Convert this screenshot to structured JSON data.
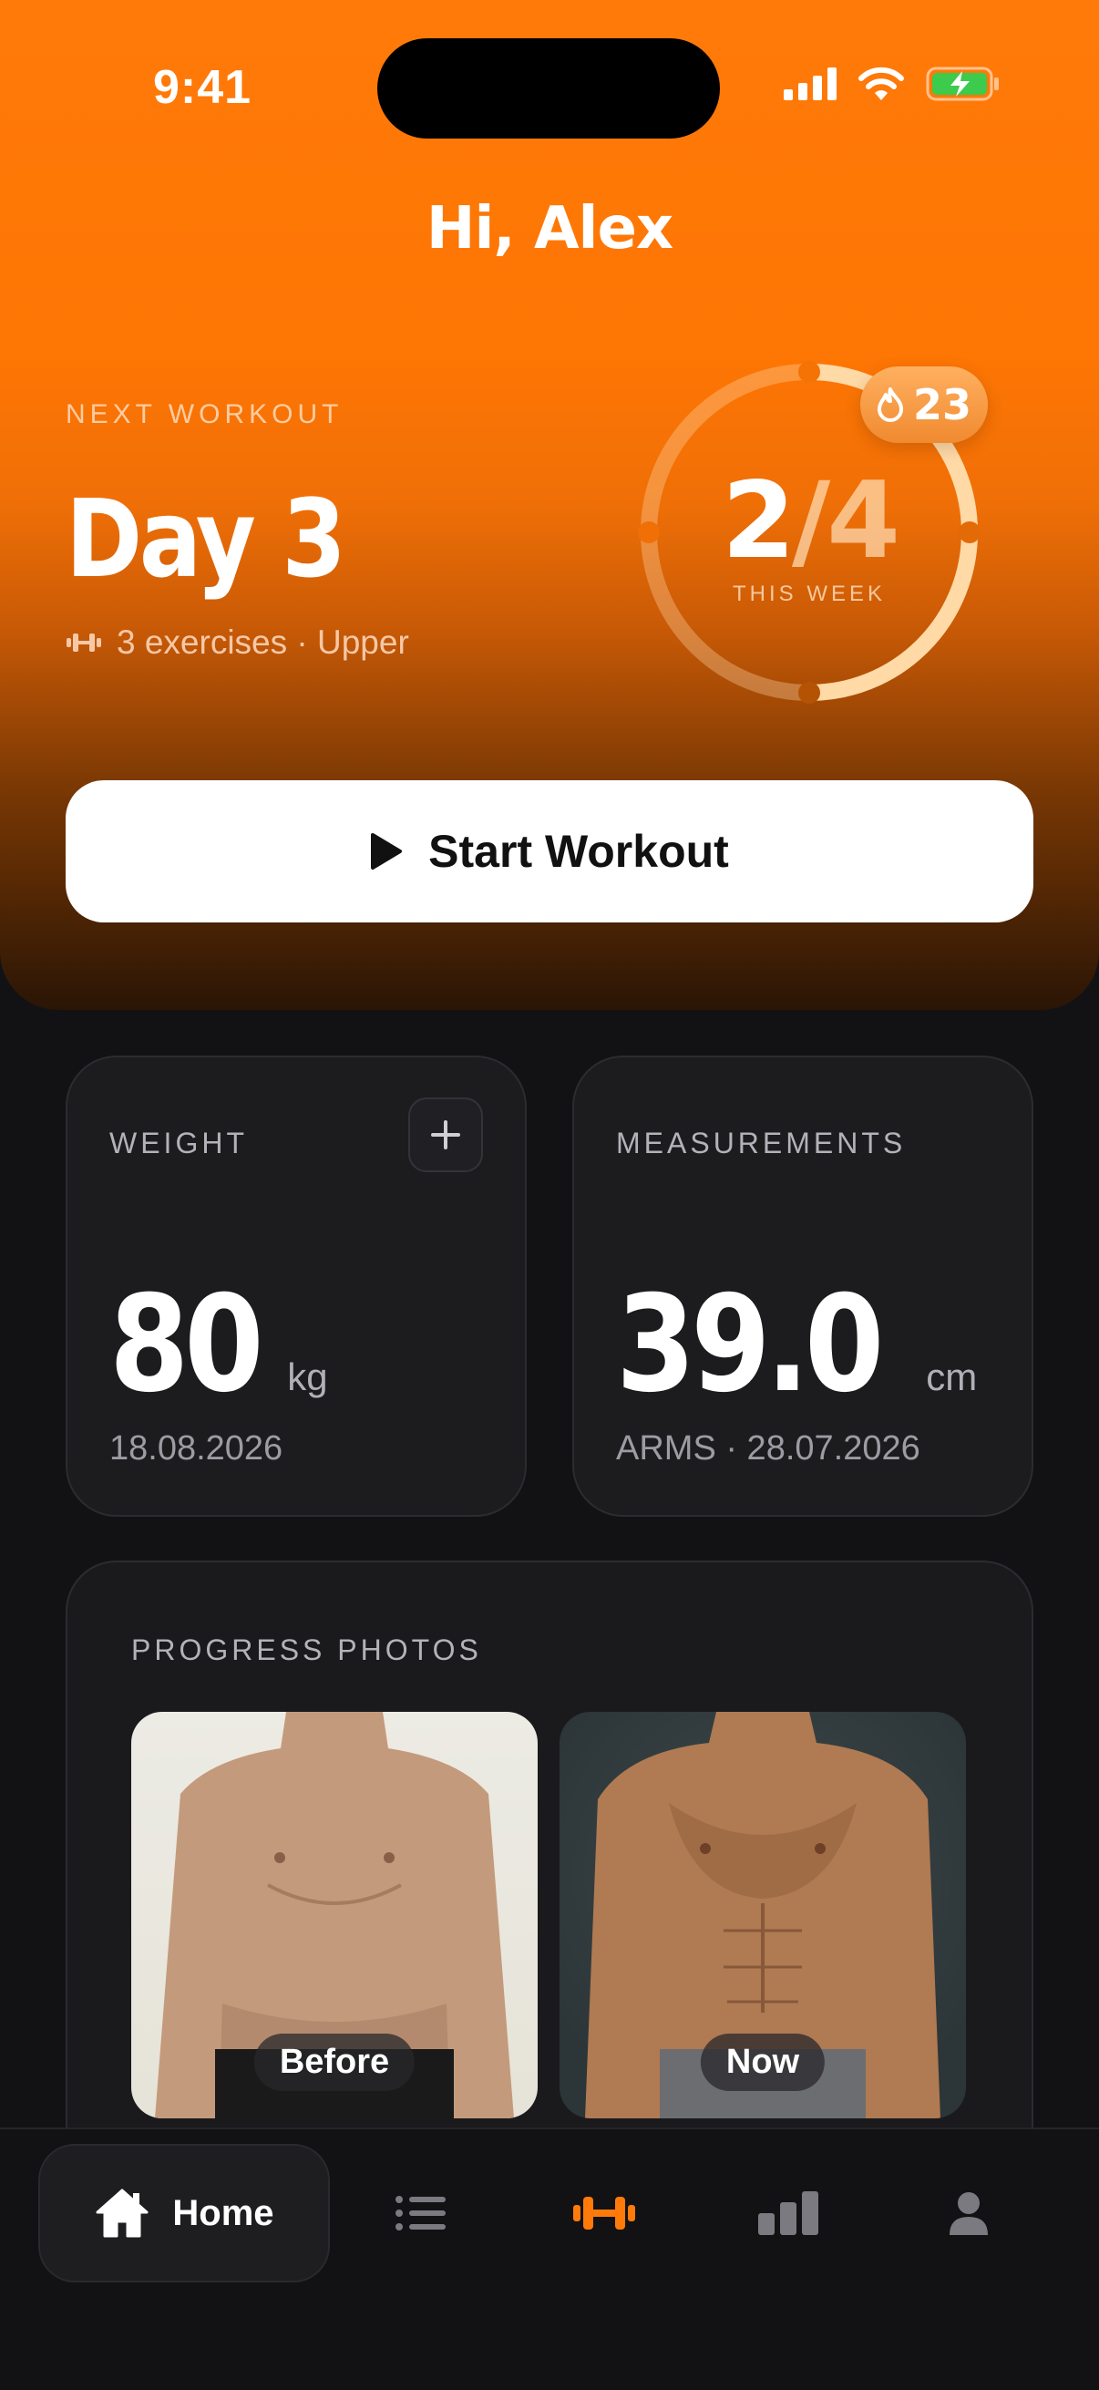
{
  "status": {
    "time": "9:41"
  },
  "greeting": "Hi, Alex",
  "next_workout": {
    "label": "NEXT WORKOUT",
    "title": "Day 3",
    "details": "3 exercises · Upper"
  },
  "weekly_progress": {
    "done": "2",
    "separator": "/",
    "total": "4",
    "label": "THIS WEEK",
    "fraction": 0.5,
    "streak": "23"
  },
  "start_button": {
    "label": "Start Workout"
  },
  "weight_card": {
    "label": "WEIGHT",
    "value": "80",
    "unit": "kg",
    "date": "18.08.2026"
  },
  "measurements_card": {
    "label": "MEASUREMENTS",
    "value": "39.0",
    "unit": "cm",
    "detail": "ARMS · 28.07.2026"
  },
  "progress_photos": {
    "label": "PROGRESS PHOTOS",
    "photos": [
      {
        "tag": "Before"
      },
      {
        "tag": "Now"
      }
    ]
  },
  "tabbar": {
    "items": [
      {
        "label": "Home",
        "icon": "home-icon",
        "active": true
      },
      {
        "label": "",
        "icon": "list-icon"
      },
      {
        "label": "",
        "icon": "dumbbell-icon"
      },
      {
        "label": "",
        "icon": "bar-chart-icon"
      },
      {
        "label": "",
        "icon": "profile-icon"
      }
    ]
  },
  "colors": {
    "accent": "#ff7a09",
    "background": "#121214",
    "card": "#1c1c1f"
  }
}
